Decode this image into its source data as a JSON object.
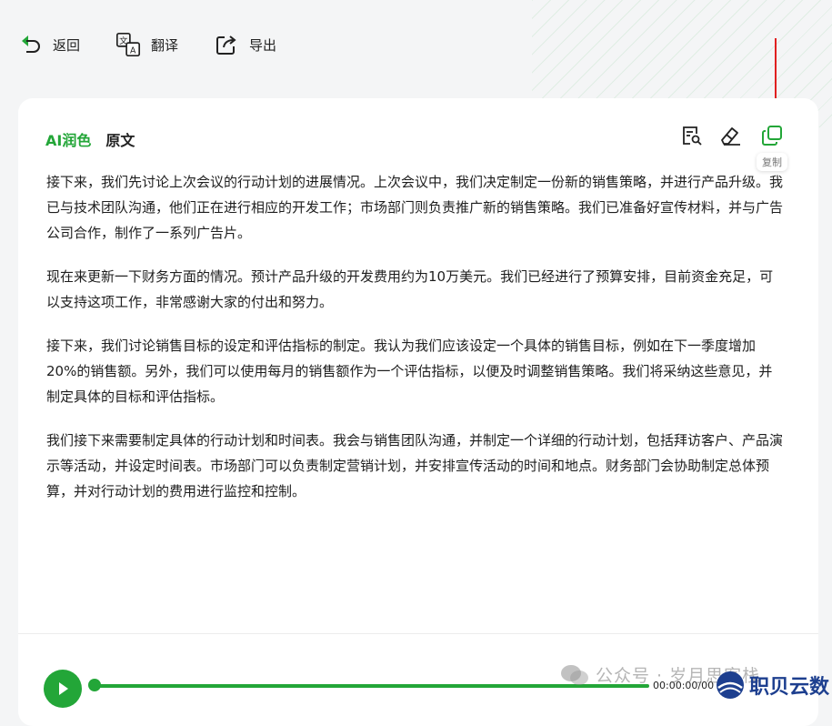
{
  "toolbar": {
    "back_label": "返回",
    "translate_label": "翻译",
    "export_label": "导出"
  },
  "tabs": [
    {
      "label": "AI润色",
      "active": true
    },
    {
      "label": "原文",
      "active": false
    }
  ],
  "actions": {
    "copy_tooltip": "复制"
  },
  "paragraphs": [
    "接下来，我们先讨论上次会议的行动计划的进展情况。上次会议中，我们决定制定一份新的销售策略，并进行产品升级。我已与技术团队沟通，他们正在进行相应的开发工作；市场部门则负责推广新的销售策略。我们已准备好宣传材料，并与广告公司合作，制作了一系列广告片。",
    "现在来更新一下财务方面的情况。预计产品升级的开发费用约为10万美元。我们已经进行了预算安排，目前资金充足，可以支持这项工作，非常感谢大家的付出和努力。",
    "接下来，我们讨论销售目标的设定和评估指标的制定。我认为我们应该设定一个具体的销售目标，例如在下一季度增加20%的销售额。另外，我们可以使用每月的销售额作为一个评估指标，以便及时调整销售策略。我们将采纳这些意见，并制定具体的目标和评估指标。",
    "我们接下来需要制定具体的行动计划和时间表。我会与销售团队沟通，并制定一个详细的行动计划，包括拜访客户、产品演示等活动，并设定时间表。市场部门可以负责制定营销计划，并安排宣传活动的时间和地点。财务部门会协助制定总体预算，并对行动计划的费用进行监控和控制。"
  ],
  "player": {
    "time_text": "00:00:00/00",
    "progress": 0
  },
  "watermark": {
    "text": "公众号 · 岁月思客栈",
    "brand": "职贝云数"
  },
  "colors": {
    "accent": "#23a638",
    "annotation": "#e02020"
  }
}
